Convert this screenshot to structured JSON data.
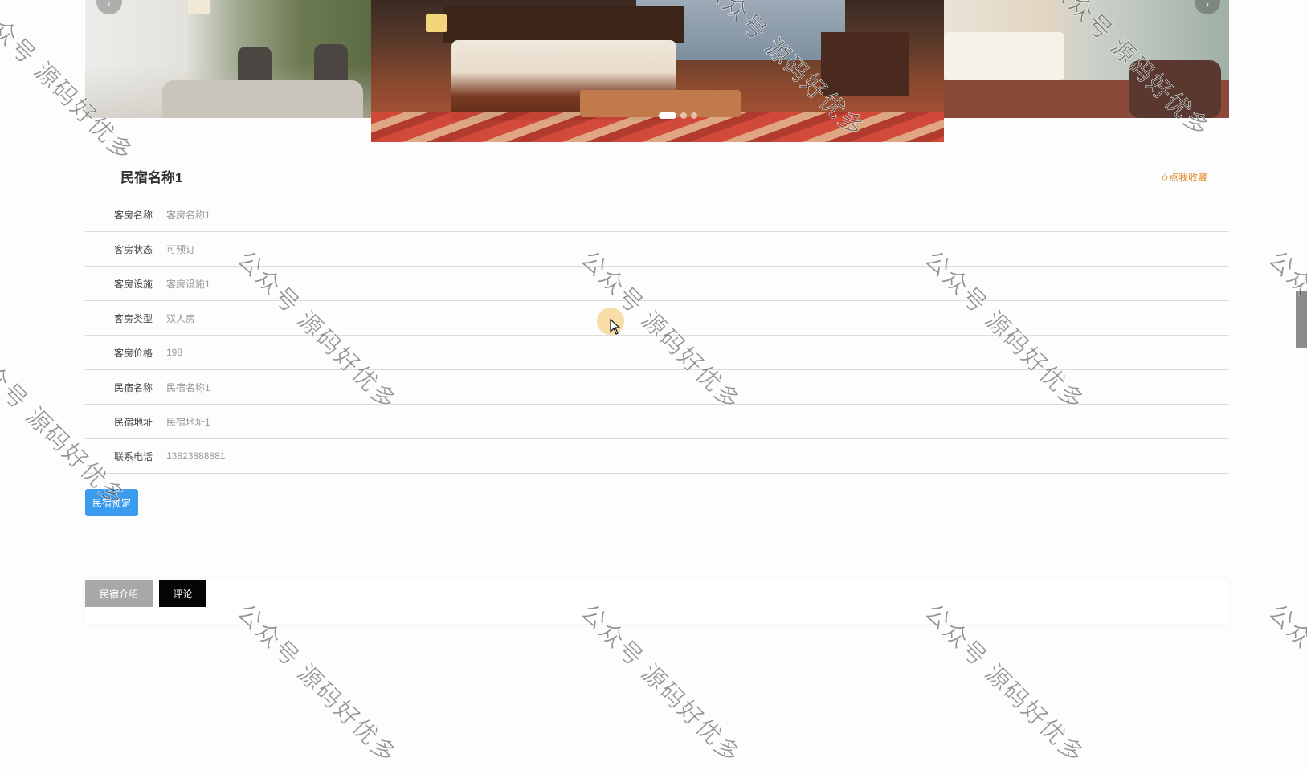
{
  "carousel": {
    "prev_label": "‹",
    "next_label": "›",
    "dot_count": 3,
    "active_index": 0
  },
  "homestay": {
    "title": "民宿名称1",
    "favorite_label": "✩点我收藏"
  },
  "details": [
    {
      "key": "客房名称",
      "value": "客房名称1"
    },
    {
      "key": "客房状态",
      "value": "可预订"
    },
    {
      "key": "客房设施",
      "value": "客房设施1"
    },
    {
      "key": "客房类型",
      "value": "双人房"
    },
    {
      "key": "客房价格",
      "value": "198"
    },
    {
      "key": "民宿名称",
      "value": "民宿名称1"
    },
    {
      "key": "民宿地址",
      "value": "民宿地址1"
    },
    {
      "key": "联系电话",
      "value": "13823888881"
    }
  ],
  "actions": {
    "book_label": "民宿预定"
  },
  "tabs": [
    {
      "label": "民宿介绍"
    },
    {
      "label": "评论"
    }
  ],
  "watermark_text": "公众号 源码好优多",
  "colors": {
    "accent_blue": "#3a9bef",
    "favorite_orange": "#e08a2e",
    "tab_inactive": "#a8a8a8",
    "tab_active": "#050505"
  }
}
